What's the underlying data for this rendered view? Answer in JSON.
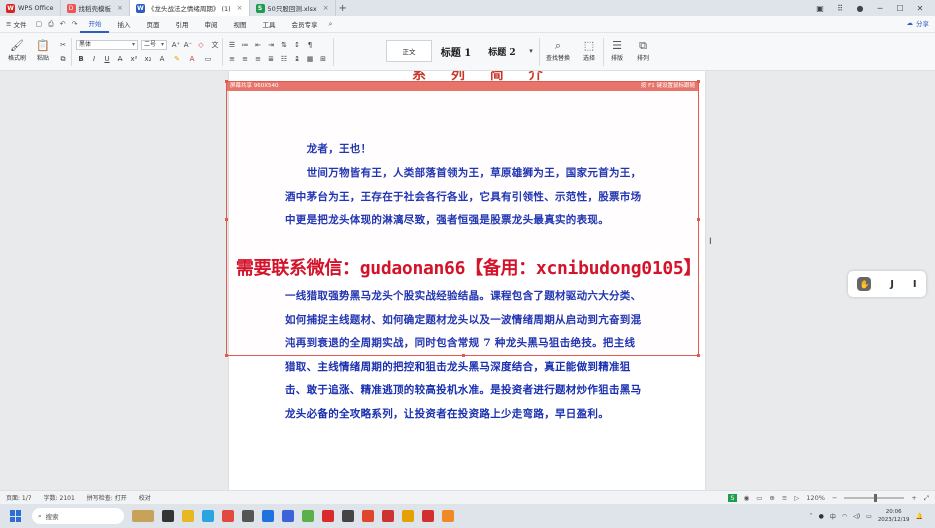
{
  "titlebar": {
    "tabs": [
      {
        "label": "WPS Office",
        "icon": "wps-logo"
      },
      {
        "label": "找稻壳模板",
        "icon": "docer-icon"
      },
      {
        "label": "《龙头战法之情绪周期》 (1)",
        "icon": "word-doc-icon",
        "active": true
      },
      {
        "label": "50只股回测.xlsx",
        "icon": "excel-icon"
      }
    ],
    "new_tab": "+"
  },
  "menubar": {
    "file": "文件",
    "items": [
      "开始",
      "插入",
      "页面",
      "引用",
      "审阅",
      "视图",
      "工具",
      "会员专享"
    ],
    "active_item": "开始",
    "share": "分享"
  },
  "toolbar": {
    "format_painter": "格式刷",
    "paste": "粘贴",
    "font_name": "黑体",
    "font_size": "二号",
    "style_normal": "正文",
    "style_h1": "标题 1",
    "style_h2": "标题 2",
    "find_replace": "查找替换",
    "select": "选择",
    "layout": "排版",
    "arrange": "排列"
  },
  "document": {
    "heading_partial": "系 列 简 介",
    "frame_label_left": "屏幕共享 960X540",
    "frame_label_right": "按 F1 键设置鼠标跟随",
    "paragraphs": [
      "　　龙者，王也！",
      "　　世间万物皆有王，人类部落首领为王，草原雄狮为王，国家元首为王，酒中茅台为王，王存在于社会各行各业，它具有引领性、示范性，股票市场中更是把龙头体现的淋漓尽致，强者恒强是股票龙头最真实的表现。",
      "一线猎取强势黑马龙头个股实战经验结晶。课程包含了题材驱动六大分类、如何捕捉主线题材、如何确定题材龙头以及一波情绪周期从启动到亢奋到混沌再到衰退的全周期实战，同时包含常规 7 种龙头黑马狙击绝技。把主线猎取、主线情绪周期的把控和狙击龙头黑马深度结合，真正能做到精准狙击、敢于追涨、精准逃顶的较高投机水准。是投资者进行题材炒作狙击黑马龙头必备的全攻略系列，让投资者在投资路上少走弯路，早日盈利。"
    ],
    "watermark": "需要联系微信：gudaonan66【备用：xcnibudong0105】"
  },
  "side_tools": {
    "pan": "✋",
    "j": "J",
    "i": "I"
  },
  "statusbar": {
    "page": "页面: 1/7",
    "words": "字数: 2101",
    "spell": "拼写检查: 打开",
    "proof": "校对",
    "zoom": "120%"
  },
  "taskbar": {
    "search": "搜索",
    "time": "20:06",
    "date": "2023/12/19"
  }
}
